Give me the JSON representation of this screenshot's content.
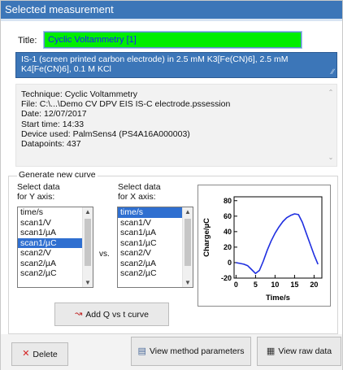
{
  "window": {
    "title": "Selected measurement"
  },
  "title_field": {
    "label": "Title:",
    "value": "Cyclic Voltammetry [1]"
  },
  "description": "IS-1 (screen printed carbon electrode) in 2.5 mM K3[Fe(CN)6], 2.5 mM K4[Fe(CN)6], 0.1 M KCl",
  "info_lines": [
    "Technique: Cyclic Voltammetry",
    "File: C:\\...\\Demo CV DPV EIS IS-C electrode.pssession",
    "Date: 12/07/2017",
    "Start time: 14:33",
    "Device used: PalmSens4 (PS4A16A000003)",
    "Datapoints: 437"
  ],
  "generate": {
    "legend": "Generate new curve",
    "y_label_1": "Select data",
    "y_label_2": "for Y axis:",
    "x_label_1": "Select data",
    "x_label_2": "for X axis:",
    "vs": "vs.",
    "y_options": [
      "time/s",
      "scan1/V",
      "scan1/µA",
      "scan1/µC",
      "scan2/V",
      "scan2/µA",
      "scan2/µC"
    ],
    "y_selected": "scan1/µC",
    "x_options": [
      "time/s",
      "scan1/V",
      "scan1/µA",
      "scan1/µC",
      "scan2/V",
      "scan2/µA",
      "scan2/µC"
    ],
    "x_selected": "time/s"
  },
  "chart_data": {
    "type": "line",
    "title": "",
    "xlabel": "Time/s",
    "ylabel": "Charge/µC",
    "xlim": [
      -0.5,
      22
    ],
    "ylim": [
      -20,
      85
    ],
    "xticks": [
      0,
      5,
      10,
      15,
      20
    ],
    "yticks": [
      -20,
      0,
      20,
      40,
      60,
      80
    ],
    "grid": false,
    "line_color": "#1f2fe0",
    "series": [
      {
        "x": [
          0,
          1,
          2,
          3,
          4,
          5,
          6,
          7,
          8,
          9,
          10,
          11,
          12,
          13,
          14,
          15,
          16,
          17,
          18,
          19,
          20,
          21
        ],
        "y": [
          0,
          -1,
          -2,
          -4,
          -9,
          -14,
          -10,
          2,
          16,
          28,
          38,
          46,
          53,
          58,
          61,
          63,
          62,
          52,
          38,
          24,
          10,
          -2
        ]
      }
    ]
  },
  "buttons": {
    "add_curve": "Add Q vs t curve",
    "delete": "Delete",
    "view_method": "View method parameters",
    "view_raw": "View raw data"
  },
  "colors": {
    "accent": "#3c76b8",
    "title_input_bg": "#00ee00",
    "delete_icon": "#d42020"
  }
}
